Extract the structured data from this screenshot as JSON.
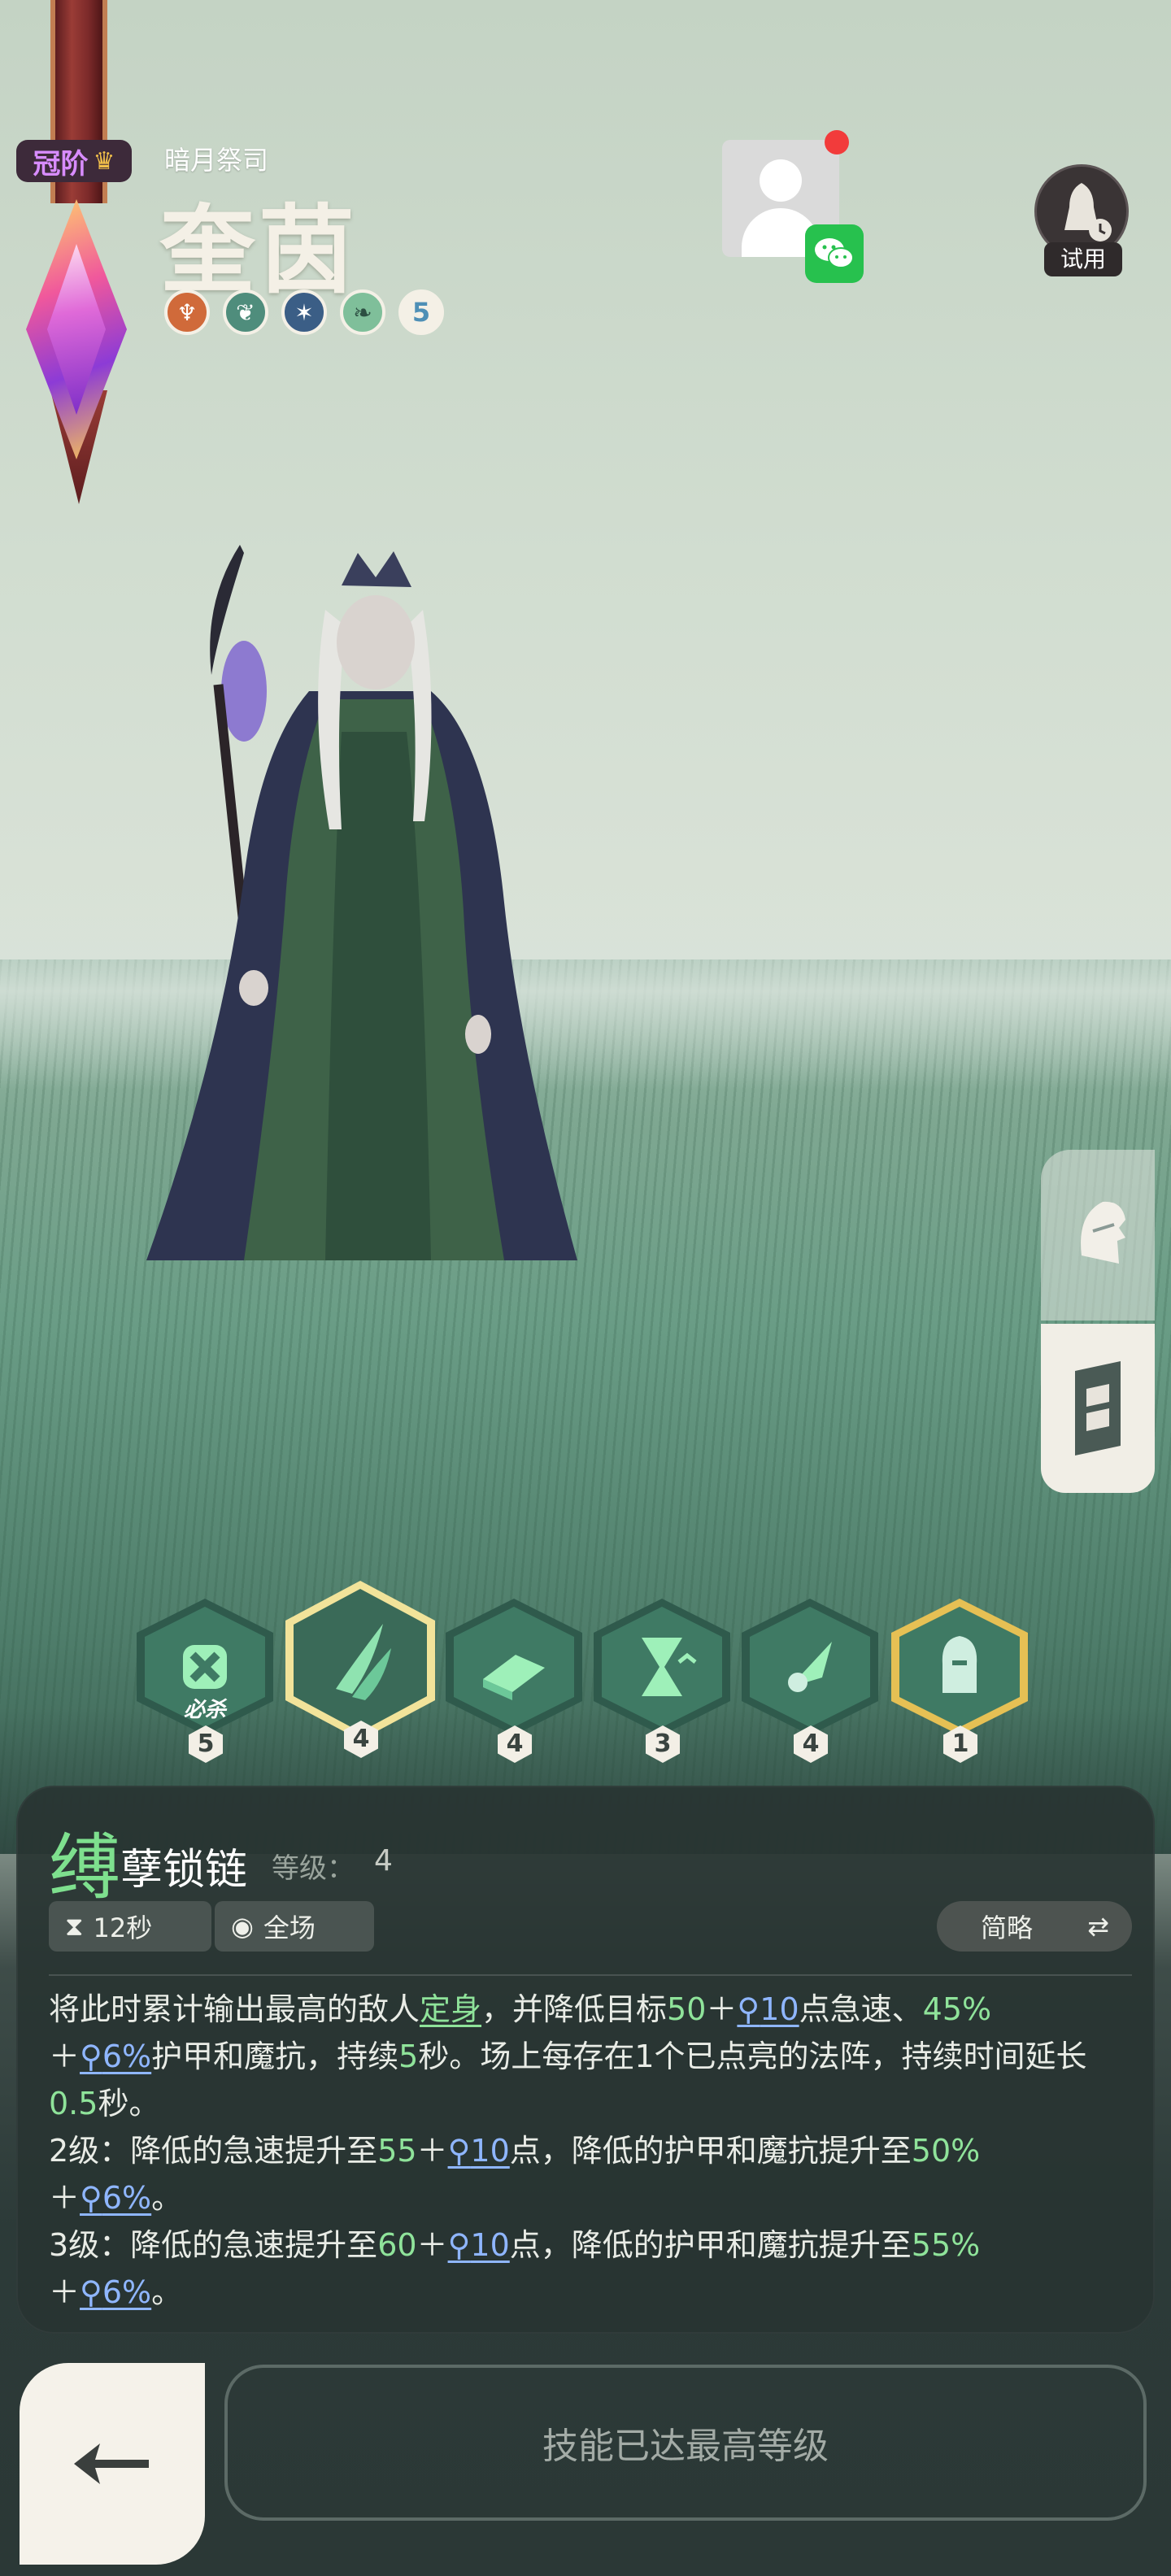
{
  "rank": {
    "label": "冠阶",
    "icon": "crown-icon"
  },
  "hero": {
    "subtitle": "暗月祭司",
    "name": "奎茵",
    "roles": [
      {
        "icon": "fire-rune-icon"
      },
      {
        "icon": "nature-rune-icon"
      },
      {
        "icon": "frost-rune-icon"
      },
      {
        "icon": "leaf-rune-icon"
      }
    ],
    "rune_count": "5"
  },
  "trial": {
    "label": "试用"
  },
  "skills": [
    {
      "icon": "knot-icon",
      "tag": "必杀",
      "level": "5"
    },
    {
      "icon": "binding-chain-icon",
      "level": "4",
      "selected": true
    },
    {
      "icon": "spellbook-icon",
      "level": "4"
    },
    {
      "icon": "hourglass-icon",
      "level": "3"
    },
    {
      "icon": "comet-icon",
      "level": "4"
    },
    {
      "icon": "knight-helm-icon",
      "level": "1",
      "special": true
    }
  ],
  "detail": {
    "name_first": "缚",
    "name_rest": "孽锁链",
    "level_label": "等级：",
    "level_value": "4",
    "cooldown": "12秒",
    "range": "全场",
    "brief_label": "简略",
    "lines": {
      "l1a": "将此时累计输出最高的敌人",
      "l1_root": "定身",
      "l1b": "，并降低目标",
      "v50": "50",
      "plus": "＋",
      "ap10": "10",
      "l1c": "点急速、",
      "v45": "45%",
      "ap6": "6%",
      "l2a": "护甲和魔抗，持续",
      "v5": "5",
      "l2b": "秒。场上每存在1个已点亮的法阵，持续时间延长",
      "v05": "0.5",
      "sec": "秒。",
      "lv2": "2级：降低的急速提升至",
      "v55": "55",
      "mid": "点，降低的护甲和魔抗提升至",
      "v50p": "50%",
      "dot": "。",
      "lv3": "3级：降低的急速提升至",
      "v60": "60",
      "v55p": "55%"
    }
  },
  "max_level_label": "技能已达最高等级",
  "colors": {
    "accent_green": "#8fe39a",
    "ap_blue": "#8fb6ff",
    "panel_bg": "#28343a",
    "wechat_green": "#27c14e",
    "notify_red": "#f23b3b"
  }
}
